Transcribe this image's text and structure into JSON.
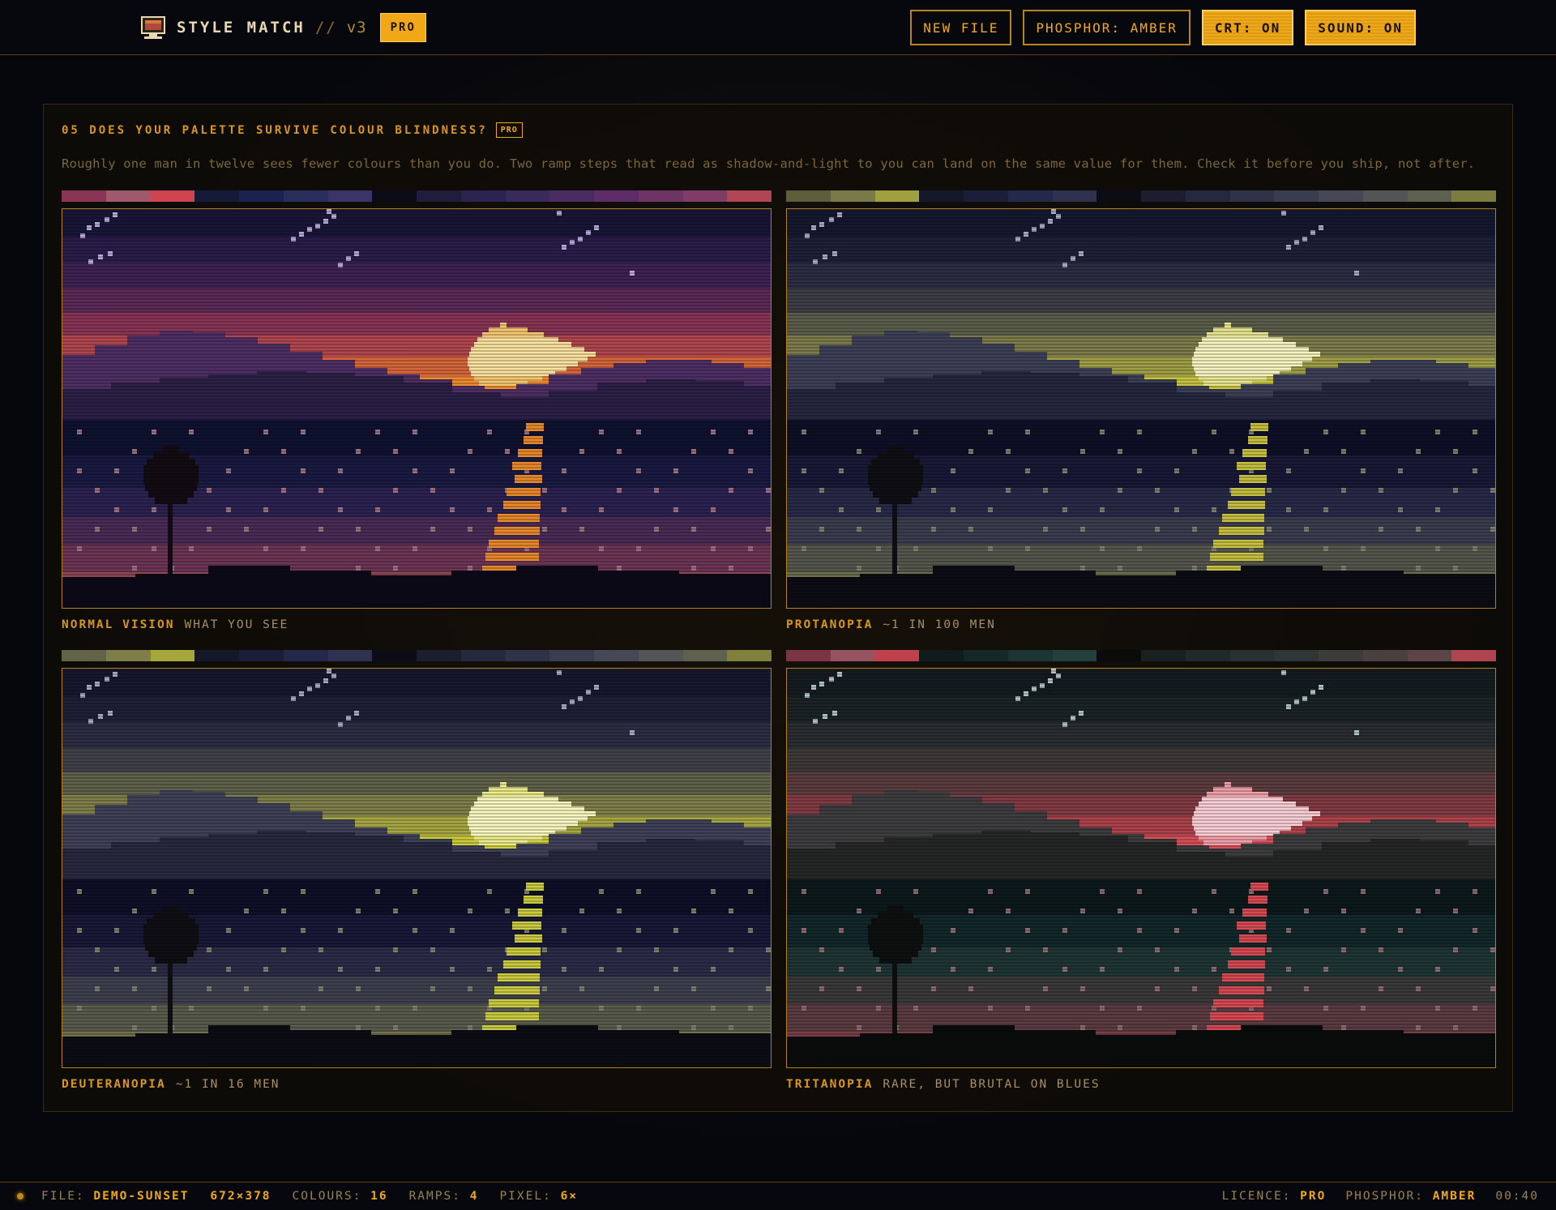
{
  "app": {
    "title": "STYLE MATCH",
    "separator": "//",
    "version": "v3",
    "badge": "PRO",
    "icon": "monitor-icon"
  },
  "toolbar": {
    "new_file": "NEW FILE",
    "phosphor": "PHOSPHOR: AMBER",
    "crt": "CRT: ON",
    "sound": "SOUND: ON"
  },
  "section": {
    "title": "05 DOES YOUR PALETTE SURVIVE COLOUR BLINDNESS?",
    "badge": "PRO",
    "description": "Roughly one man in twelve sees fewer colours than you do. Two ramp steps that read as shadow-and-light to you can land on the same value for them. Check it before you ship, not after."
  },
  "views": [
    {
      "name": "NORMAL VISION",
      "sub": "WHAT YOU SEE",
      "palette": {
        "sky": [
          "#1a1638",
          "#2a1d4a",
          "#3e2354",
          "#5e2a57",
          "#8a3456",
          "#b24750",
          "#d8663c",
          "#f08a30"
        ],
        "sun": [
          "#f4c770",
          "#fbe2a0"
        ],
        "hill_far": "#4e2f66",
        "hill_mid": "#2d2048",
        "water": [
          "#0f1230",
          "#1a1a44",
          "#2c2352",
          "#4a2c57",
          "#6e3656",
          "#8e4652"
        ],
        "reflect": "#e88a2c",
        "ground": "#0c0a18",
        "tree": "#140c14",
        "star": "#b8a8d8",
        "dot": "#9a7080"
      },
      "swatches": [
        "#8a3456",
        "#a0596c",
        "#d04450",
        "#141a38",
        "#1c2250",
        "#2a2e5c",
        "#3a3468",
        "#0c0c18",
        "#201c3c",
        "#2b2450",
        "#392a5c",
        "#4a2c60",
        "#5e2c66",
        "#6e3466",
        "#7e3c66",
        "#b04654"
      ]
    },
    {
      "name": "PROTANOPIA",
      "sub": "~1 IN 100 MEN",
      "palette": {
        "sky": [
          "#161830",
          "#1e2038",
          "#2c2e44",
          "#3e4048",
          "#5c5e4c",
          "#7c7c4c",
          "#a0a048",
          "#c8c640"
        ],
        "sun": [
          "#e8e690",
          "#f6f4c0"
        ],
        "hill_far": "#3e4058",
        "hill_mid": "#262840",
        "water": [
          "#0e1028",
          "#181a38",
          "#282a48",
          "#3c3e50",
          "#56584e",
          "#6e6e4c"
        ],
        "reflect": "#c8c040",
        "ground": "#0c0c14",
        "tree": "#101014",
        "star": "#a8a8c4",
        "dot": "#7c7c70"
      },
      "swatches": [
        "#5c5e3c",
        "#7a7a48",
        "#a0a040",
        "#141828",
        "#1a1e38",
        "#24284a",
        "#2e3250",
        "#0c0c14",
        "#1c1e30",
        "#262840",
        "#30324a",
        "#3a3c50",
        "#464856",
        "#525456",
        "#5e6050",
        "#7c7c40"
      ]
    },
    {
      "name": "DEUTERANOPIA",
      "sub": "~1 IN 16 MEN",
      "palette": {
        "sky": [
          "#161830",
          "#1e2038",
          "#2c2e44",
          "#40424a",
          "#60624c",
          "#80804a",
          "#a6a844",
          "#cccc3c"
        ],
        "sun": [
          "#ecec8c",
          "#f8f8c0"
        ],
        "hill_far": "#40425a",
        "hill_mid": "#282a40",
        "water": [
          "#0e1028",
          "#181a38",
          "#2a2c48",
          "#3e4050",
          "#5a5c4e",
          "#72724a"
        ],
        "reflect": "#cccc40",
        "ground": "#0c0c14",
        "tree": "#101014",
        "star": "#a8a8c4",
        "dot": "#7e7e6e"
      },
      "swatches": [
        "#626448",
        "#7e7e48",
        "#a6a83c",
        "#141828",
        "#1a1e38",
        "#24284a",
        "#2e3250",
        "#0c0c14",
        "#1c1e30",
        "#262840",
        "#30324a",
        "#3a3c50",
        "#464856",
        "#525456",
        "#5e6050",
        "#80803c"
      ]
    },
    {
      "name": "TRITANOPIA",
      "sub": "RARE, BUT BRUTAL ON BLUES",
      "palette": {
        "sky": [
          "#141c20",
          "#1c2426",
          "#2a2e30",
          "#3e3a3a",
          "#5c3e40",
          "#843c44",
          "#b0444c",
          "#d85058"
        ],
        "sun": [
          "#f0a0a8",
          "#fcd0d4"
        ],
        "hill_far": "#3e3e40",
        "hill_mid": "#262828",
        "water": [
          "#0c1a1c",
          "#12282a",
          "#1e3634",
          "#3a3a3a",
          "#5c3c42",
          "#7c3e46"
        ],
        "reflect": "#d84a54",
        "ground": "#0a0c0c",
        "tree": "#0e1010",
        "star": "#b0c4c4",
        "dot": "#8c6a70"
      },
      "swatches": [
        "#7a3444",
        "#965460",
        "#c0404c",
        "#101c1c",
        "#142828",
        "#1c3434",
        "#24403c",
        "#0a0c0c",
        "#1a2020",
        "#202a28",
        "#283030",
        "#303636",
        "#3c3c3c",
        "#4a4040",
        "#5c4448",
        "#b04450"
      ]
    }
  ],
  "status": {
    "file_label": "FILE:",
    "file": "DEMO-SUNSET",
    "dims": "672×378",
    "colours_label": "COLOURS:",
    "colours": "16",
    "ramps_label": "RAMPS:",
    "ramps": "4",
    "pixel_label": "PIXEL:",
    "pixel": "6×",
    "licence_label": "LICENCE:",
    "licence": "PRO",
    "phosphor_label": "PHOSPHOR:",
    "phosphor": "AMBER",
    "time": "00:40"
  }
}
